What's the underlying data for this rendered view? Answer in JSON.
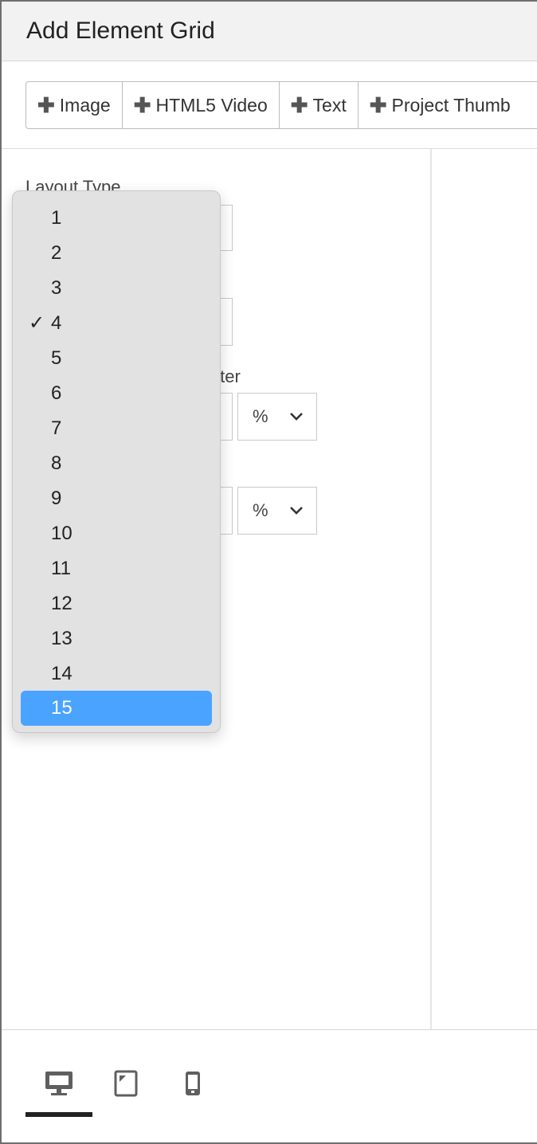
{
  "dialog": {
    "title": "Add Element Grid"
  },
  "toolbar": {
    "buttons": [
      {
        "label": "Image",
        "icon": "plus-icon"
      },
      {
        "label": "HTML5 Video",
        "icon": "plus-icon"
      },
      {
        "label": "Text",
        "icon": "plus-icon"
      },
      {
        "label": "Project Thumb",
        "icon": "plus-icon"
      }
    ]
  },
  "form": {
    "layout_type_label": "Layout Type",
    "gutter_label_partial": "tter",
    "unit_1": "%",
    "unit_2": "%"
  },
  "dropdown": {
    "options": [
      "1",
      "2",
      "3",
      "4",
      "5",
      "6",
      "7",
      "8",
      "9",
      "10",
      "11",
      "12",
      "13",
      "14",
      "15"
    ],
    "checked_value": "4",
    "highlighted_value": "15",
    "highlight_color": "#4aa3ff"
  },
  "footer": {
    "device_tabs": [
      {
        "name": "desktop-icon",
        "active": true
      },
      {
        "name": "tablet-icon",
        "active": false
      },
      {
        "name": "mobile-icon",
        "active": false
      }
    ]
  }
}
